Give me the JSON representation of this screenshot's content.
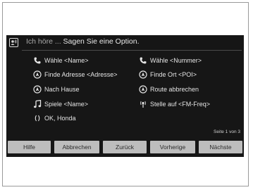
{
  "header": {
    "prompt_hint": "Ich höre ... ",
    "prompt_main": "Sagen Sie eine Option."
  },
  "commands": [
    {
      "label": "Wähle <Name>",
      "icon": "phone-icon"
    },
    {
      "label": "Wähle <Nummer>",
      "icon": "phone-icon"
    },
    {
      "label": "Finde Adresse <Adresse>",
      "icon": "navigation-icon"
    },
    {
      "label": "Finde Ort <POI>",
      "icon": "navigation-icon"
    },
    {
      "label": "Nach Hause",
      "icon": "navigation-icon"
    },
    {
      "label": "Route abbrechen",
      "icon": "navigation-icon"
    },
    {
      "label": "Spiele <Name>",
      "icon": "music-note-icon"
    },
    {
      "label": "Stelle auf <FM-Freq>",
      "icon": "radio-icon"
    },
    {
      "label": "OK, Honda",
      "icon": "honda-assistant-icon"
    }
  ],
  "page_indicator": "Seite 1 von 3",
  "buttons": {
    "help": "Hilfe",
    "cancel": "Abbrechen",
    "back": "Zurück",
    "previous": "Vorherige",
    "next": "Nächste"
  }
}
